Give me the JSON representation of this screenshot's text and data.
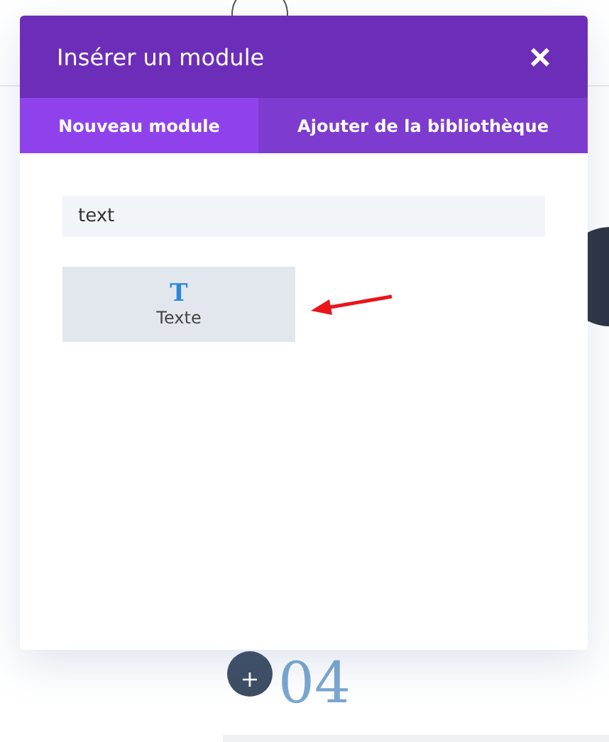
{
  "background": {
    "number": "04",
    "add_button": "+"
  },
  "modal": {
    "title": "Insérer un module",
    "close": "×",
    "tabs": [
      {
        "label": "Nouveau module",
        "selected": true
      },
      {
        "label": "Ajouter de la bibliothèque",
        "selected": false
      }
    ],
    "search": {
      "value": "text"
    },
    "modules": [
      {
        "icon": "T",
        "label": "Texte"
      }
    ]
  }
}
